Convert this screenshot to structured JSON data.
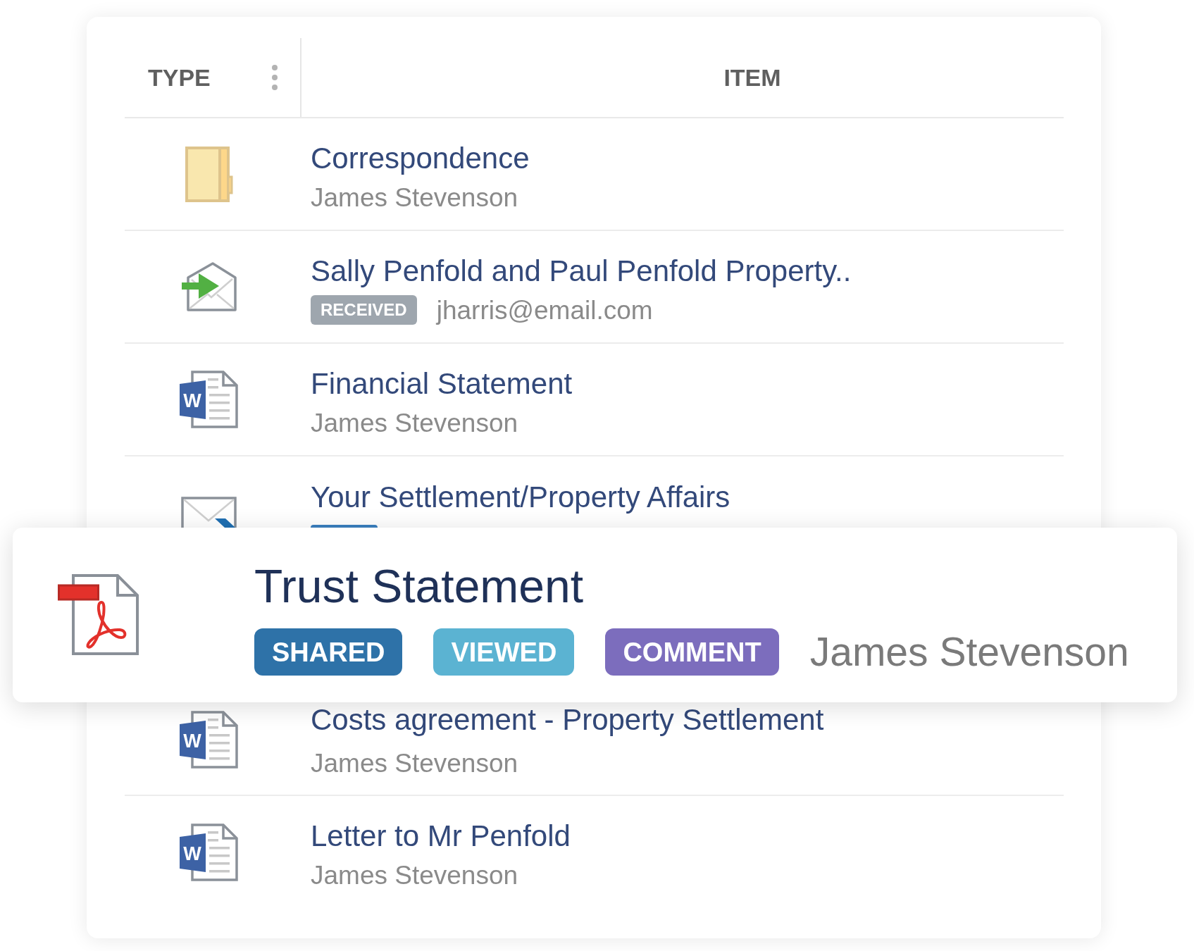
{
  "table": {
    "columns": [
      "TYPE",
      "ITEM"
    ],
    "rows": [
      {
        "kind": "folder",
        "title": "Correspondence",
        "subtitle": "James Stevenson",
        "dragged": false
      },
      {
        "kind": "email_in",
        "title": "Sally Penfold and Paul Penfold Property..",
        "tags": [
          {
            "label": "RECEIVED",
            "color": "#9ea6ae"
          }
        ],
        "subtitle": "jharris@email.com",
        "dragged": false
      },
      {
        "kind": "word",
        "icon_text": "W",
        "title": "Financial Statement",
        "subtitle": "James Stevenson",
        "dragged": false
      },
      {
        "kind": "email_out",
        "title": "Your Settlement/Property Affairs",
        "tags": [
          {
            "color": "#3a7fbf"
          }
        ],
        "dragged": false
      },
      {
        "kind": "pdf",
        "title": "Trust Statement",
        "tags": [
          {
            "label": "SHARED",
            "color": "#2e72a8"
          },
          {
            "label": "VIEWED",
            "color": "#5bb3d2"
          },
          {
            "label": "COMMENT",
            "color": "#7c6dbd"
          }
        ],
        "author": "James Stevenson",
        "dragged": true
      },
      {
        "kind": "word",
        "icon_text": "W",
        "title": "Costs agreement - Property Settlement",
        "subtitle": "James Stevenson",
        "dragged": false
      },
      {
        "kind": "word",
        "icon_text": "W",
        "title": "Letter to Mr Penfold",
        "subtitle": "James Stevenson",
        "dragged": false
      }
    ]
  }
}
